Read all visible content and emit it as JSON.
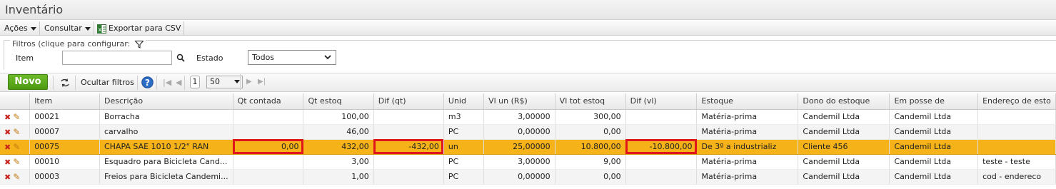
{
  "window": {
    "title": "Inventário"
  },
  "toolbar": {
    "acoes": "Ações",
    "consultar": "Consultar",
    "exportar": "Exportar para CSV"
  },
  "filters": {
    "legend": "Filtros (clique para configurar:",
    "item_label": "Item",
    "item_value": "",
    "estado_label": "Estado",
    "estado_value": "Todos"
  },
  "grid_toolbar": {
    "novo": "Novo",
    "ocultar": "Ocultar filtros",
    "page": "1",
    "page_size": "50"
  },
  "columns": [
    "Item",
    "Descrição",
    "Qt contada",
    "Qt estoq",
    "Dif (qt)",
    "Unid",
    "Vl un (R$)",
    "Vl tot estoq",
    "Dif (vl)",
    "Estoque",
    "Dono do estoque",
    "Em posse de",
    "Endereço de esto"
  ],
  "rows": [
    {
      "item": "00021",
      "descricao": "Borracha",
      "qt_contada": "",
      "qt_estoq": "100,00",
      "dif_qt": "",
      "unid": "m3",
      "vl_un": "3,00000",
      "vl_tot": "300,00",
      "dif_vl": "",
      "estoque": "Matéria-prima",
      "dono": "Candemil Ltda",
      "posse": "Candemil Ltda",
      "endereco": ""
    },
    {
      "item": "00007",
      "descricao": "carvalho",
      "qt_contada": "",
      "qt_estoq": "46,00",
      "dif_qt": "",
      "unid": "PC",
      "vl_un": "0,00000",
      "vl_tot": "0,00",
      "dif_vl": "",
      "estoque": "Matéria-prima",
      "dono": "Candemil Ltda",
      "posse": "Candemil Ltda",
      "endereco": ""
    },
    {
      "item": "00075",
      "descricao": "CHAPA SAE 1010 1/2\" RAN",
      "qt_contada": "0,00",
      "qt_estoq": "432,00",
      "dif_qt": "-432,00",
      "unid": "un",
      "vl_un": "25,00000",
      "vl_tot": "10.800,00",
      "dif_vl": "-10.800,00",
      "estoque": "De 3º a industrializ",
      "dono": "Cliente 456",
      "posse": "Candemil Ltda",
      "endereco": ""
    },
    {
      "item": "00010",
      "descricao": "Esquadro para Bicicleta Cand...",
      "qt_contada": "",
      "qt_estoq": "3,00",
      "dif_qt": "",
      "unid": "PC",
      "vl_un": "3,00000",
      "vl_tot": "9,00",
      "dif_vl": "",
      "estoque": "Matéria-prima",
      "dono": "Candemil Ltda",
      "posse": "Candemil Ltda",
      "endereco": "teste - teste"
    },
    {
      "item": "00003",
      "descricao": "Freios para Bicicleta Candemi...",
      "qt_contada": "",
      "qt_estoq": "1,00",
      "dif_qt": "",
      "unid": "PC",
      "vl_un": "0,00000",
      "vl_tot": "0,00",
      "dif_vl": "",
      "estoque": "Matéria-prima",
      "dono": "Candemil Ltda",
      "posse": "Candemil Ltda",
      "endereco": "cod - endereco"
    }
  ],
  "colors": {
    "selected_row": "#f5b319",
    "highlight_border": "#e0141b",
    "novo_button": "#5aa81c"
  }
}
